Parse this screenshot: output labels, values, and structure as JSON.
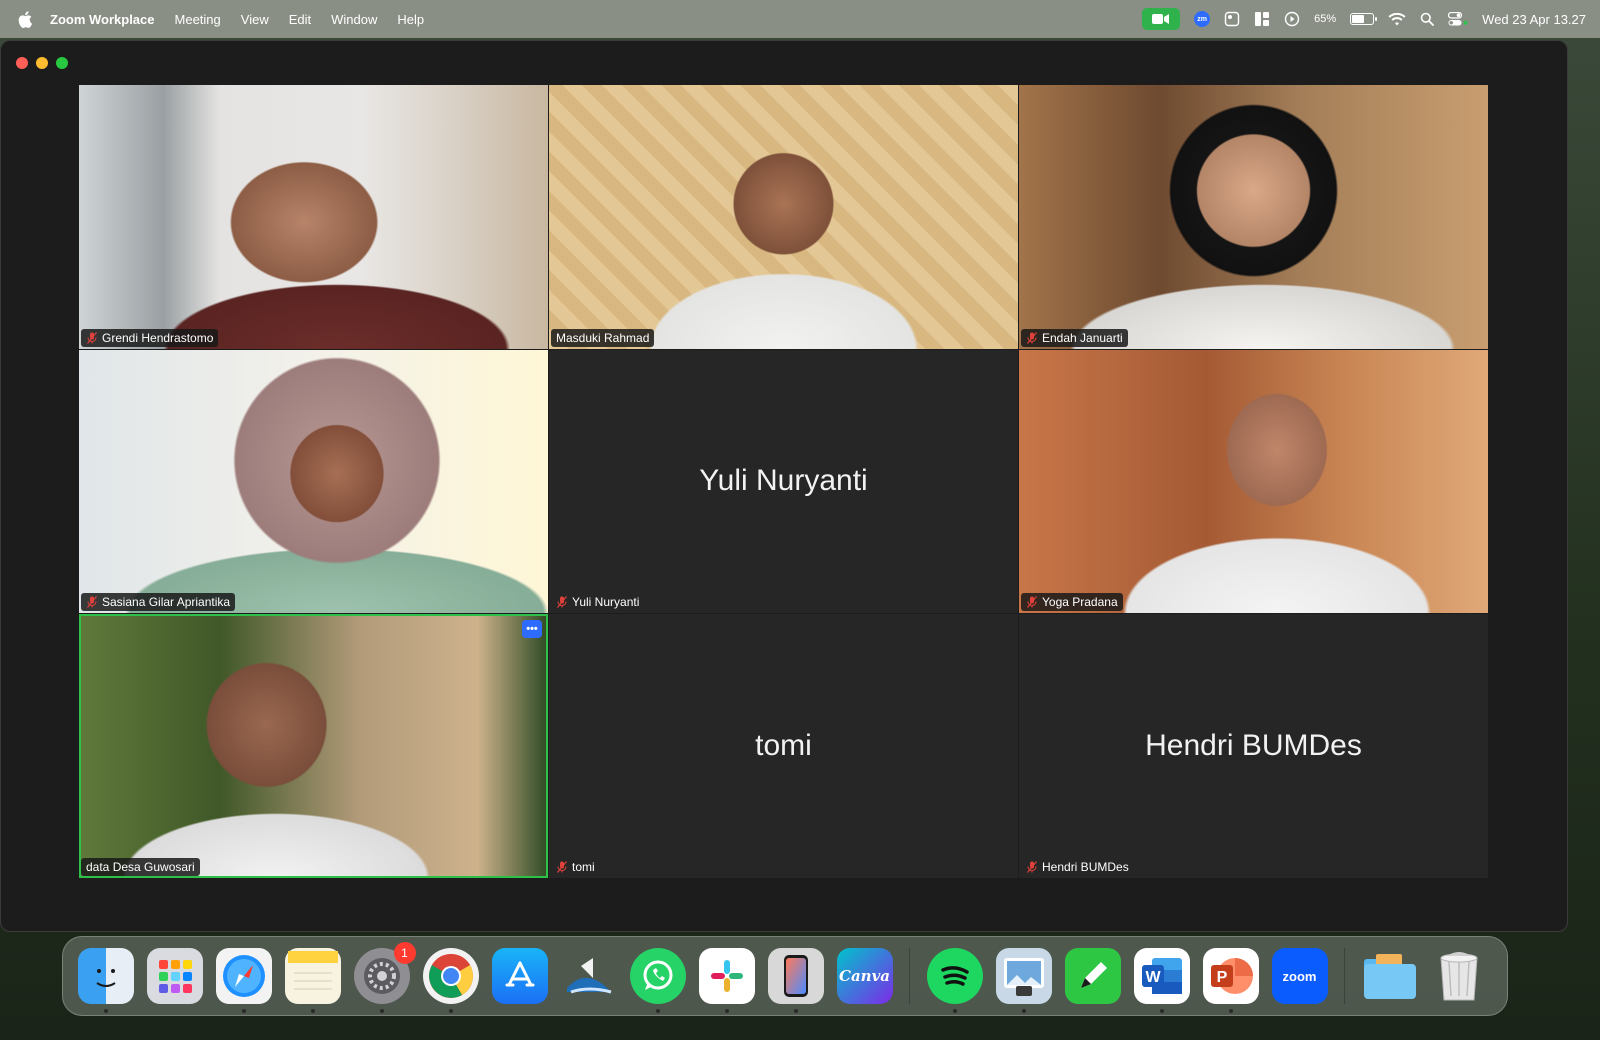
{
  "menubar": {
    "app_name": "Zoom Workplace",
    "menus": [
      "Meeting",
      "View",
      "Edit",
      "Window",
      "Help"
    ],
    "battery_percent": "65%",
    "battery_level": 0.65,
    "clock": "Wed 23 Apr  13.27"
  },
  "participants": [
    {
      "name": "Grendi Hendrastomo",
      "muted": true,
      "video": true
    },
    {
      "name": "Masduki Rahmad",
      "muted": false,
      "video": true
    },
    {
      "name": "Endah Januarti",
      "muted": true,
      "video": true
    },
    {
      "name": "Sasiana Gilar Apriantika",
      "muted": true,
      "video": true
    },
    {
      "name": "Yuli Nuryanti",
      "muted": true,
      "video": false,
      "display_name": "Yuli Nuryanti"
    },
    {
      "name": "Yoga Pradana",
      "muted": true,
      "video": true
    },
    {
      "name": "data Desa Guwosari",
      "muted": false,
      "video": true,
      "active_speaker": true
    },
    {
      "name": "tomi",
      "muted": true,
      "video": false,
      "display_name": "tomi"
    },
    {
      "name": "Hendri BUMDes",
      "muted": true,
      "video": false,
      "display_name": "Hendri BUMDes"
    }
  ],
  "more_button_label": "•••",
  "dock": {
    "settings_badge": "1",
    "word_letter": "W",
    "ppt_letter": "P",
    "canva_label": "Canva",
    "zoom_label": "zoom"
  },
  "colors": {
    "active_speaker": "#2fc04a",
    "muted_mic": "#e0413a",
    "zoom_blue": "#2d6cff"
  }
}
